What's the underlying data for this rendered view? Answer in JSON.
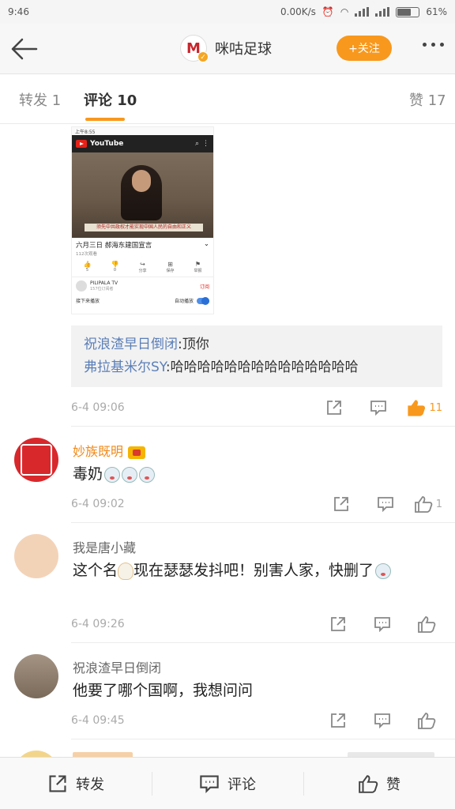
{
  "status_bar": {
    "time": "9:46",
    "network_speed": "0.00K/s",
    "battery": "61%"
  },
  "header": {
    "title": "咪咕足球",
    "follow_label": "+关注"
  },
  "tabs": [
    {
      "label": "转发 1"
    },
    {
      "label": "评论 10"
    },
    {
      "label": "赞 17"
    }
  ],
  "embedded_video": {
    "status": "上午8:55",
    "app": "YouTube",
    "banner": "须先中共政权才能实现中国人民的自由和正义",
    "title": "六月三日 郝海东建国宣言",
    "views": "112次观看",
    "actions": [
      {
        "icon": "👍",
        "label": "5"
      },
      {
        "icon": "👎",
        "label": "0"
      },
      {
        "icon": "↪",
        "label": "分享"
      },
      {
        "icon": "⊞",
        "label": "保存"
      },
      {
        "icon": "⚑",
        "label": "举报"
      }
    ],
    "channel": "PILIPALA TV",
    "subscribers": "157位订阅者",
    "subscribe_label": "订阅",
    "next_label": "接下来播放",
    "autoplay_label": "自动播放"
  },
  "quoted_replies": [
    {
      "user": "祝浪渣早日倒闭",
      "text": ":顶你"
    },
    {
      "user": "弗拉基米尔SY",
      "text": ":哈哈哈哈哈哈哈哈哈哈哈哈哈哈"
    }
  ],
  "main_meta": {
    "time": "6-4 09:06",
    "likes": "11"
  },
  "comments": [
    {
      "user": "妙族既明",
      "text": "毒奶",
      "time": "6-4 09:02",
      "likes": "1"
    },
    {
      "user": "我是唐小藏",
      "text_a": "这个名",
      "text_b": "现在瑟瑟发抖吧！别害人家，快删了",
      "time": "6-4 09:26",
      "likes": ""
    },
    {
      "user": "祝浪渣早日倒闭",
      "text": "他要了哪个国啊，我想问问",
      "time": "6-4 09:45",
      "likes": ""
    }
  ],
  "bottom_bar": {
    "repost": "转发",
    "comment": "评论",
    "like": "赞"
  },
  "colors": {
    "accent": "#f8981d",
    "link": "#5b7fb8",
    "name_orange": "#f08a19"
  }
}
